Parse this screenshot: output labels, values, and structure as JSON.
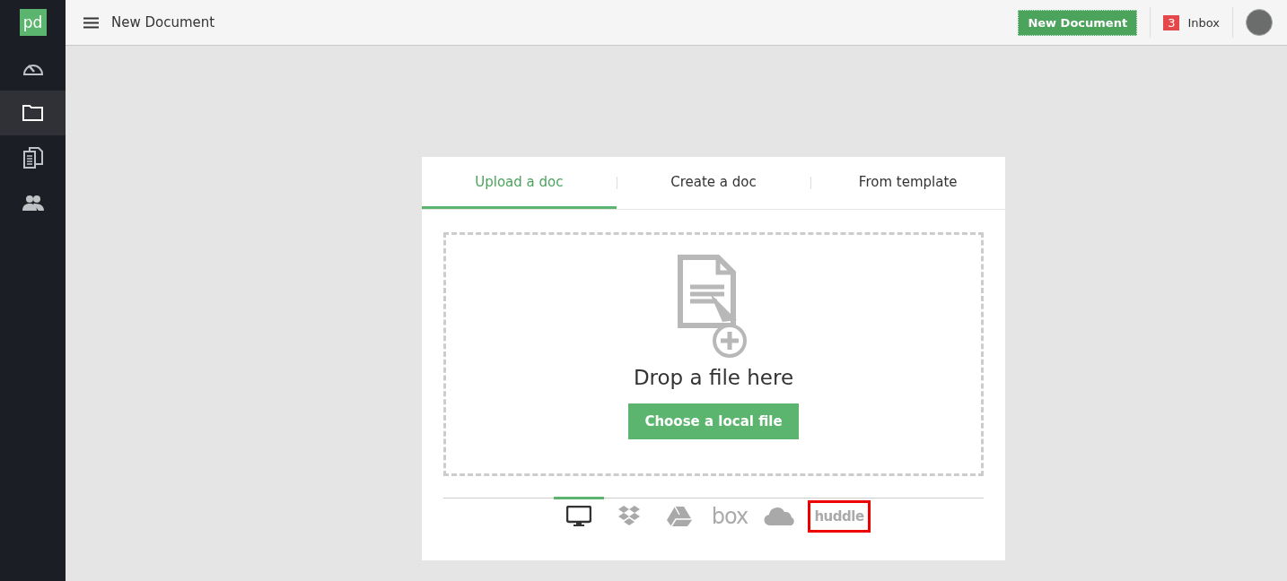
{
  "sidebar": {
    "logo": "pd",
    "items": [
      {
        "kind": "dashboard",
        "selected": false
      },
      {
        "kind": "folder",
        "selected": true
      },
      {
        "kind": "documents",
        "selected": false
      },
      {
        "kind": "contacts",
        "selected": false
      }
    ]
  },
  "topbar": {
    "title": "New Document",
    "new_button": "New Document",
    "inbox": {
      "count": "3",
      "label": "Inbox"
    }
  },
  "tabs": [
    {
      "label": "Upload a doc",
      "selected": true
    },
    {
      "label": "Create a doc",
      "selected": false
    },
    {
      "label": "From template",
      "selected": false
    }
  ],
  "dropzone": {
    "text": "Drop a file here",
    "button": "Choose a local file"
  },
  "sources": [
    {
      "kind": "computer",
      "selected": true,
      "highlighted": false
    },
    {
      "kind": "dropbox",
      "selected": false,
      "highlighted": false
    },
    {
      "kind": "drive",
      "selected": false,
      "highlighted": false
    },
    {
      "kind": "box",
      "label": "box",
      "selected": false,
      "highlighted": false
    },
    {
      "kind": "onedrive",
      "selected": false,
      "highlighted": false
    },
    {
      "kind": "huddle",
      "label": "huddle",
      "selected": false,
      "highlighted": true
    }
  ]
}
